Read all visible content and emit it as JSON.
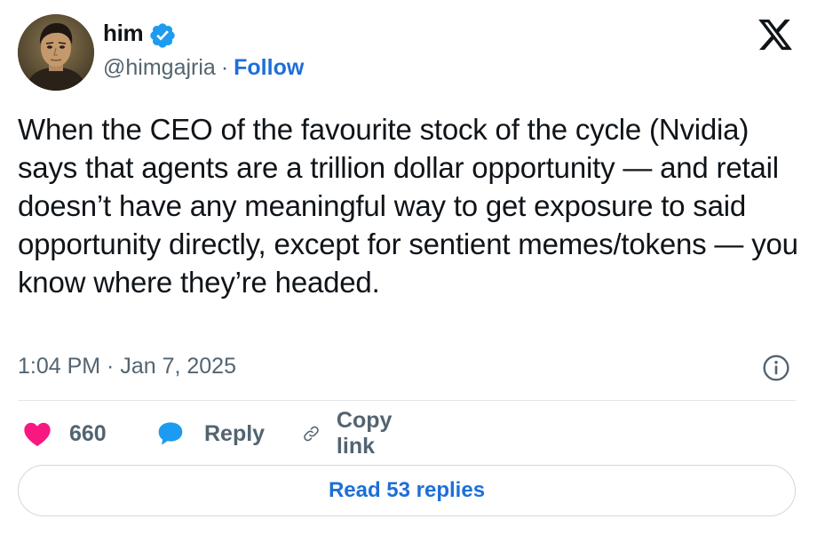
{
  "author": {
    "display_name": "him",
    "handle": "@himgajria",
    "separator": "·",
    "follow_label": "Follow",
    "verified": true
  },
  "icons": {
    "avatar": "avatar",
    "verified": "verified-badge-icon",
    "logo": "x-logo-icon",
    "info": "info-icon",
    "like": "heart-icon",
    "reply": "speech-bubble-icon",
    "copy": "link-icon"
  },
  "tweet": {
    "text": "When the CEO of the favourite stock of the cycle (Nvidia) says that agents are a trillion dollar opportunity — and retail doesn’t have any meaningful way to get exposure to said opportunity directly, except for sentient memes/tokens — you know where they’re headed.",
    "timestamp": "1:04 PM · Jan 7, 2025"
  },
  "actions": {
    "like_count": "660",
    "reply_label": "Reply",
    "copy_label": "Copy link"
  },
  "replies_button_label": "Read 53 replies",
  "colors": {
    "text": "#0f1419",
    "secondary": "#536471",
    "link": "#1d6fd8",
    "heart": "#f91880",
    "verified": "#1d9bf0",
    "reply_icon": "#1d9bf0",
    "border": "#cfd9de"
  }
}
